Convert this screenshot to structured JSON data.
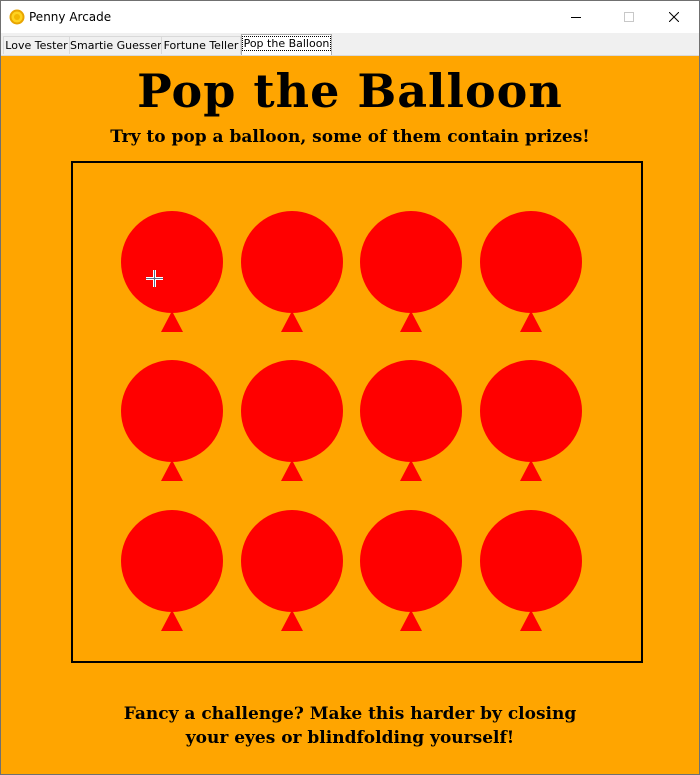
{
  "window": {
    "title": "Penny Arcade",
    "icon": "penny-coin-icon",
    "controls": [
      "minimize-icon",
      "maximize-icon",
      "close-icon"
    ]
  },
  "tabs": [
    {
      "label": "Love Tester",
      "active": false
    },
    {
      "label": "Smartie Guesser",
      "active": false
    },
    {
      "label": "Fortune Teller",
      "active": false
    },
    {
      "label": "Pop the Balloon",
      "active": true
    }
  ],
  "game": {
    "title": "Pop the Balloon",
    "subtitle": "Try to pop a balloon, some of them contain prizes!",
    "footer_line1": "Fancy a challenge? Make this harder by closing",
    "footer_line2": "your eyes or blindfolding yourself!",
    "balloon_rows": 3,
    "balloon_cols": 4,
    "balloon_count": 12
  },
  "colors": {
    "background": "#ffa500",
    "balloon": "#ff0000",
    "text": "#000000"
  }
}
